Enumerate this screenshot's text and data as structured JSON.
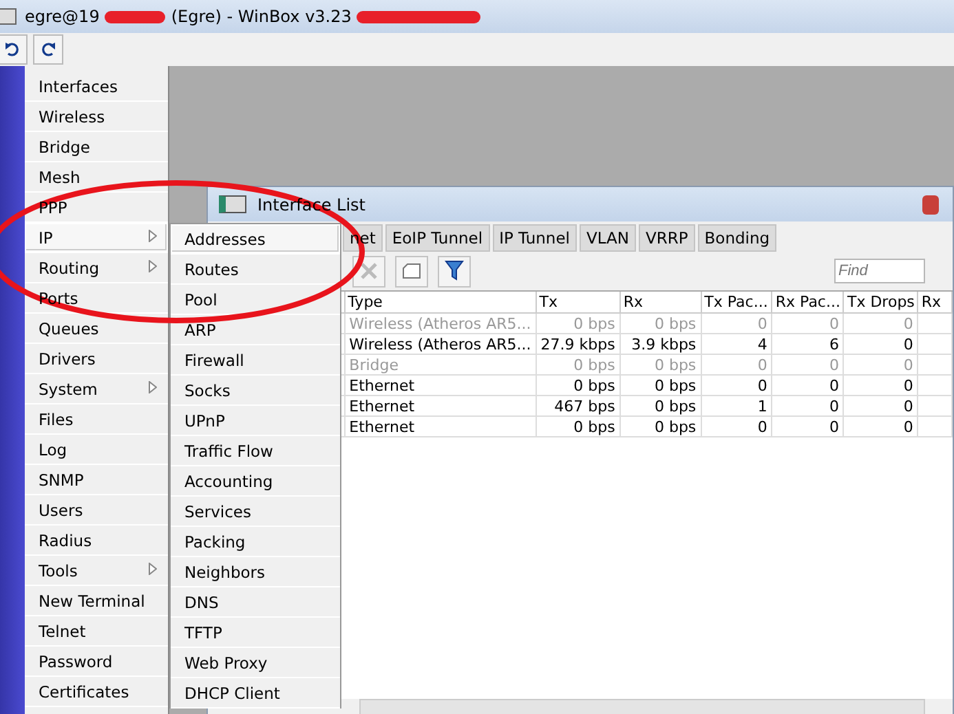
{
  "window": {
    "title_start": "egre@19",
    "title_end": "(Egre) - WinBox v3.23"
  },
  "menu": [
    {
      "label": "Interfaces",
      "submenu": false,
      "selected": false
    },
    {
      "label": "Wireless",
      "submenu": false,
      "selected": false
    },
    {
      "label": "Bridge",
      "submenu": false,
      "selected": false
    },
    {
      "label": "Mesh",
      "submenu": false,
      "selected": false
    },
    {
      "label": "PPP",
      "submenu": false,
      "selected": false
    },
    {
      "label": "IP",
      "submenu": true,
      "selected": true
    },
    {
      "label": "Routing",
      "submenu": true,
      "selected": false
    },
    {
      "label": "Ports",
      "submenu": false,
      "selected": false
    },
    {
      "label": "Queues",
      "submenu": false,
      "selected": false
    },
    {
      "label": "Drivers",
      "submenu": false,
      "selected": false
    },
    {
      "label": "System",
      "submenu": true,
      "selected": false
    },
    {
      "label": "Files",
      "submenu": false,
      "selected": false
    },
    {
      "label": "Log",
      "submenu": false,
      "selected": false
    },
    {
      "label": "SNMP",
      "submenu": false,
      "selected": false
    },
    {
      "label": "Users",
      "submenu": false,
      "selected": false
    },
    {
      "label": "Radius",
      "submenu": false,
      "selected": false
    },
    {
      "label": "Tools",
      "submenu": true,
      "selected": false
    },
    {
      "label": "New Terminal",
      "submenu": false,
      "selected": false
    },
    {
      "label": "Telnet",
      "submenu": false,
      "selected": false
    },
    {
      "label": "Password",
      "submenu": false,
      "selected": false
    },
    {
      "label": "Certificates",
      "submenu": false,
      "selected": false
    }
  ],
  "submenu": [
    {
      "label": "Addresses",
      "selected": true
    },
    {
      "label": "Routes",
      "selected": false
    },
    {
      "label": "Pool",
      "selected": false
    },
    {
      "label": "ARP",
      "selected": false
    },
    {
      "label": "Firewall",
      "selected": false
    },
    {
      "label": "Socks",
      "selected": false
    },
    {
      "label": "UPnP",
      "selected": false
    },
    {
      "label": "Traffic Flow",
      "selected": false
    },
    {
      "label": "Accounting",
      "selected": false
    },
    {
      "label": "Services",
      "selected": false
    },
    {
      "label": "Packing",
      "selected": false
    },
    {
      "label": "Neighbors",
      "selected": false
    },
    {
      "label": "DNS",
      "selected": false
    },
    {
      "label": "TFTP",
      "selected": false
    },
    {
      "label": "Web Proxy",
      "selected": false
    },
    {
      "label": "DHCP Client",
      "selected": false
    }
  ],
  "interface_window": {
    "title": "Interface List",
    "tabs": [
      {
        "label": "net",
        "selected": false
      },
      {
        "label": "EoIP Tunnel",
        "selected": false
      },
      {
        "label": "IP Tunnel",
        "selected": false
      },
      {
        "label": "VLAN",
        "selected": false
      },
      {
        "label": "VRRP",
        "selected": false
      },
      {
        "label": "Bonding",
        "selected": false
      }
    ],
    "find_placeholder": "Find",
    "table": {
      "columns": [
        "Type",
        "Tx",
        "Rx",
        "Tx Pac...",
        "Rx Pac...",
        "Tx Drops",
        "Rx"
      ],
      "rows": [
        {
          "disabled": true,
          "cells": [
            "Wireless (Atheros AR5...",
            "0 bps",
            "0 bps",
            "0",
            "0",
            "0"
          ]
        },
        {
          "disabled": false,
          "cells": [
            "Wireless (Atheros AR5...",
            "27.9 kbps",
            "3.9 kbps",
            "4",
            "6",
            "0"
          ]
        },
        {
          "disabled": true,
          "cells": [
            "Bridge",
            "0 bps",
            "0 bps",
            "0",
            "0",
            "0"
          ]
        },
        {
          "disabled": false,
          "cells": [
            "Ethernet",
            "0 bps",
            "0 bps",
            "0",
            "0",
            "0"
          ]
        },
        {
          "disabled": false,
          "cells": [
            "Ethernet",
            "467 bps",
            "0 bps",
            "1",
            "0",
            "0"
          ]
        },
        {
          "disabled": false,
          "cells": [
            "Ethernet",
            "0 bps",
            "0 bps",
            "0",
            "0",
            "0"
          ]
        }
      ]
    }
  }
}
